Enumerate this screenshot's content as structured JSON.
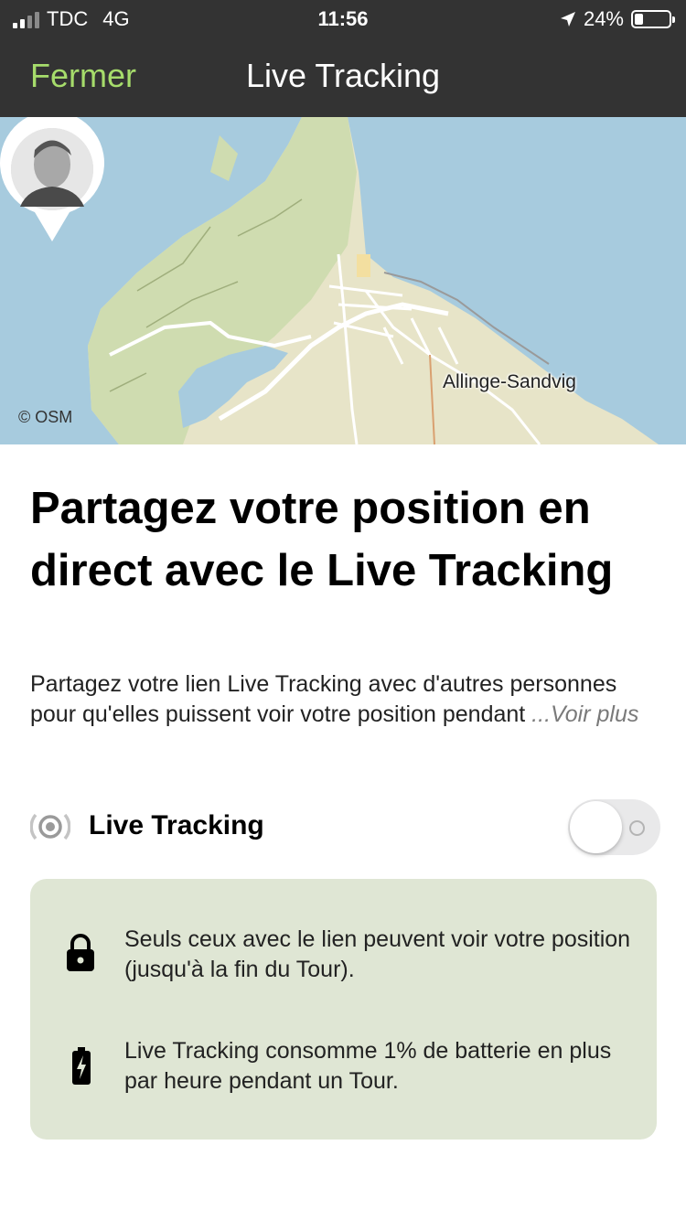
{
  "status_bar": {
    "carrier": "TDC",
    "network": "4G",
    "time": "11:56",
    "battery": "24%"
  },
  "nav": {
    "close_label": "Fermer",
    "title": "Live Tracking",
    "accent_color": "#a6dc6b"
  },
  "map": {
    "attribution": "© OSM",
    "place_label": "Allinge-Sandvig"
  },
  "content": {
    "headline": "Partagez votre position en direct avec le Live Tracking",
    "description": "Partagez votre lien Live Tracking avec d'autres personnes pour qu'elles puissent voir votre position pendant",
    "more_link": " ...Voir plus"
  },
  "toggle": {
    "label": "Live Tracking",
    "state": "off"
  },
  "info": {
    "items": [
      {
        "icon": "lock-icon",
        "text": "Seuls ceux avec le lien peuvent voir votre position (jusqu'à la fin du Tour)."
      },
      {
        "icon": "battery-charging-icon",
        "text": "Live Tracking consomme 1% de batterie en plus par heure pendant un Tour."
      }
    ]
  }
}
